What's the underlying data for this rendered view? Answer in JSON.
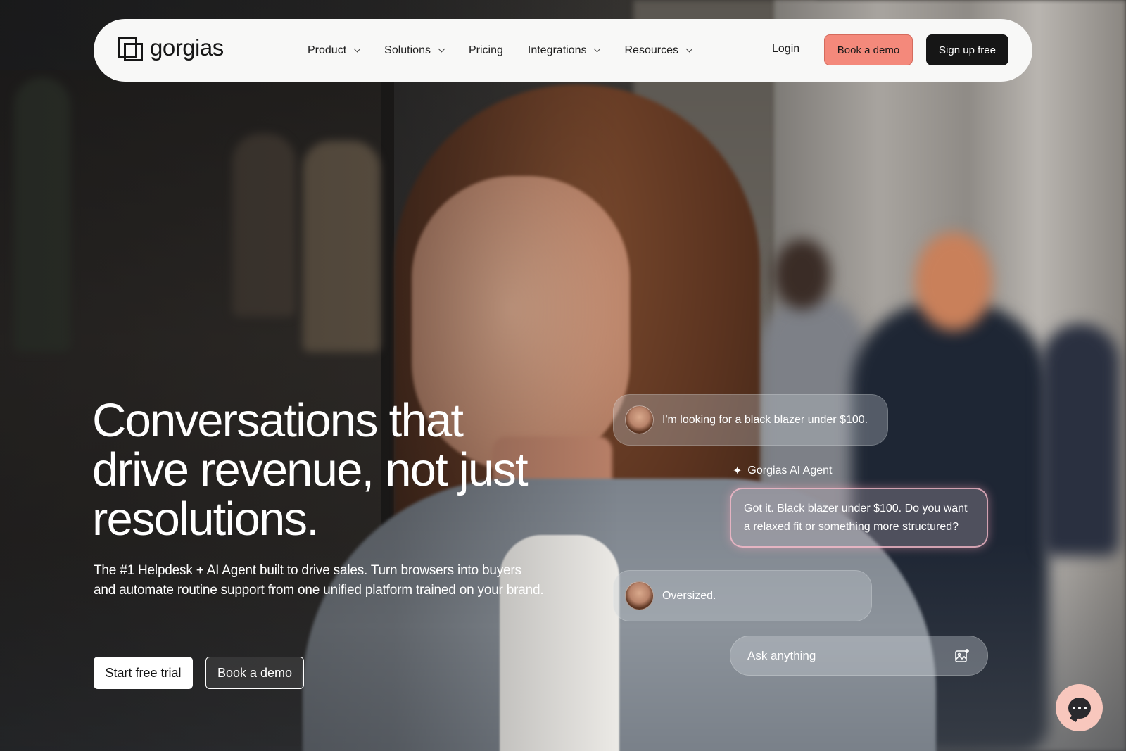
{
  "nav": {
    "logo_text": "gorgias",
    "items": [
      {
        "label": "Product",
        "has_dropdown": true
      },
      {
        "label": "Solutions",
        "has_dropdown": true
      },
      {
        "label": "Pricing",
        "has_dropdown": false
      },
      {
        "label": "Integrations",
        "has_dropdown": true
      },
      {
        "label": "Resources",
        "has_dropdown": true
      }
    ],
    "login_label": "Login",
    "demo_label": "Book a demo",
    "signup_label": "Sign up free"
  },
  "hero": {
    "headline": "Conversations that drive revenue, not just resolutions.",
    "subtext": "The #1 Helpdesk + AI Agent built to drive sales. Turn browsers into buyers and automate routine support from one unified platform trained on your brand.",
    "primary_cta": "Start free trial",
    "secondary_cta": "Book a demo"
  },
  "chat": {
    "user_message_1": "I'm looking for a black blazer under $100.",
    "agent_name": "Gorgias AI Agent",
    "agent_message": "Got it. Black blazer under $100. Do you want a relaxed fit or something more structured?",
    "user_message_2": "Oversized.",
    "input_placeholder": "Ask anything"
  },
  "colors": {
    "accent": "#f4897b",
    "dark": "#161616",
    "navbar_bg": "#f8f8f7",
    "launcher_bg": "#f8c7bd"
  },
  "icons": {
    "agent": "sparkle-icon",
    "input_action": "image-add-icon",
    "launcher": "chat-icon"
  }
}
